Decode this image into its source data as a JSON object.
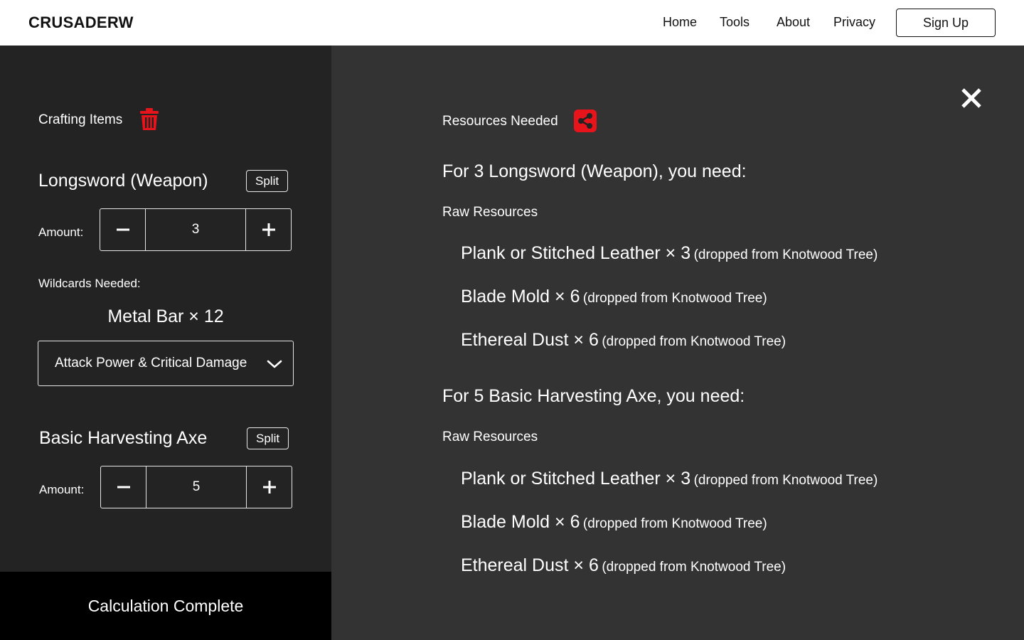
{
  "header": {
    "brand": "CRUSADERW",
    "nav": [
      "Home",
      "Tools",
      "About",
      "Privacy"
    ],
    "signup_label": "Sign Up"
  },
  "left_panel": {
    "title": "Crafting Items",
    "items": [
      {
        "name": "Longsword (Weapon)",
        "split_label": "Split",
        "amount_label": "Amount:",
        "amount": "3"
      },
      {
        "name": "Basic Harvesting Axe",
        "split_label": "Split",
        "amount_label": "Amount:",
        "amount": "5"
      }
    ],
    "wildcards_label": "Wildcards Needed:",
    "wildcard_value": "Metal Bar × 12",
    "stat_select": "Attack Power & Critical Damage",
    "footer_label": "Calculation Complete"
  },
  "right_panel": {
    "title": "Resources Needed",
    "sections": [
      {
        "heading": "For 3 Longsword (Weapon), you need:",
        "raw_label": "Raw Resources",
        "lines": [
          {
            "main": "Plank or Stitched Leather × 3",
            "source": "(dropped from Knotwood Tree)"
          },
          {
            "main": "Blade Mold × 6",
            "source": "(dropped from Knotwood Tree)"
          },
          {
            "main": "Ethereal Dust × 6",
            "source": "(dropped from Knotwood Tree)"
          }
        ]
      },
      {
        "heading": "For 5 Basic Harvesting Axe, you need:",
        "raw_label": "Raw Resources",
        "lines": [
          {
            "main": "Plank or Stitched Leather × 3",
            "source": "(dropped from Knotwood Tree)"
          },
          {
            "main": "Blade Mold × 6",
            "source": "(dropped from Knotwood Tree)"
          },
          {
            "main": "Ethereal Dust × 6",
            "source": "(dropped from Knotwood Tree)"
          }
        ]
      }
    ]
  },
  "colors": {
    "accent": "#e8141c",
    "left_bg": "#232323",
    "right_bg": "#333333",
    "header_bg": "#ffffff"
  },
  "icons": [
    "trash-icon",
    "minus-icon",
    "plus-icon",
    "chevron-down-icon",
    "close-icon",
    "share-icon"
  ]
}
